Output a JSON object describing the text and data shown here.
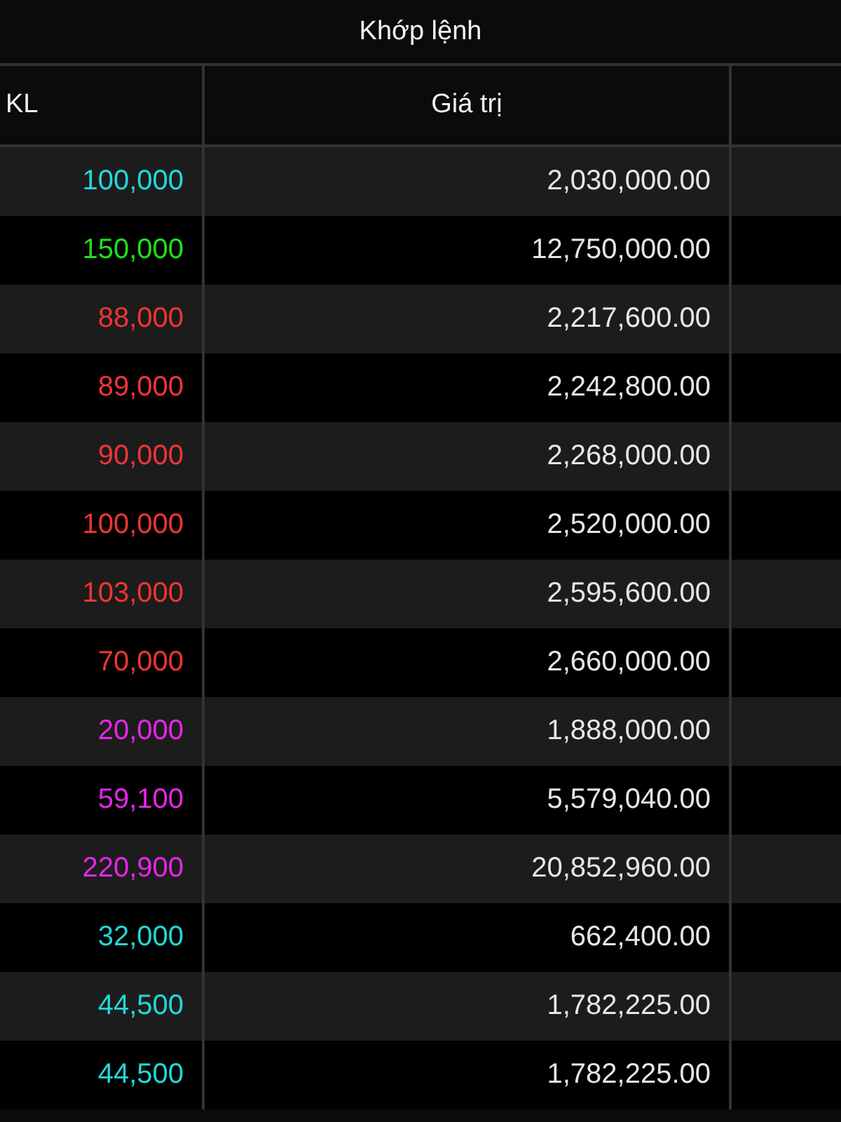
{
  "title": "Khớp lệnh",
  "columns": [
    "KL",
    "Giá trị"
  ],
  "rows": [
    {
      "volume": "100,000",
      "value": "2,030,000.00",
      "color": "#22d8d8"
    },
    {
      "volume": "150,000",
      "value": "12,750,000.00",
      "color": "#1ee01e"
    },
    {
      "volume": "88,000",
      "value": "2,217,600.00",
      "color": "#f03434"
    },
    {
      "volume": "89,000",
      "value": "2,242,800.00",
      "color": "#f03434"
    },
    {
      "volume": "90,000",
      "value": "2,268,000.00",
      "color": "#f03434"
    },
    {
      "volume": "100,000",
      "value": "2,520,000.00",
      "color": "#f03434"
    },
    {
      "volume": "103,000",
      "value": "2,595,600.00",
      "color": "#f03434"
    },
    {
      "volume": "70,000",
      "value": "2,660,000.00",
      "color": "#f03434"
    },
    {
      "volume": "20,000",
      "value": "1,888,000.00",
      "color": "#e626e6"
    },
    {
      "volume": "59,100",
      "value": "5,579,040.00",
      "color": "#e626e6"
    },
    {
      "volume": "220,900",
      "value": "20,852,960.00",
      "color": "#e626e6"
    },
    {
      "volume": "32,000",
      "value": "662,400.00",
      "color": "#22d8d8"
    },
    {
      "volume": "44,500",
      "value": "1,782,225.00",
      "color": "#22d8d8"
    },
    {
      "volume": "44,500",
      "value": "1,782,225.00",
      "color": "#22d8d8"
    }
  ]
}
